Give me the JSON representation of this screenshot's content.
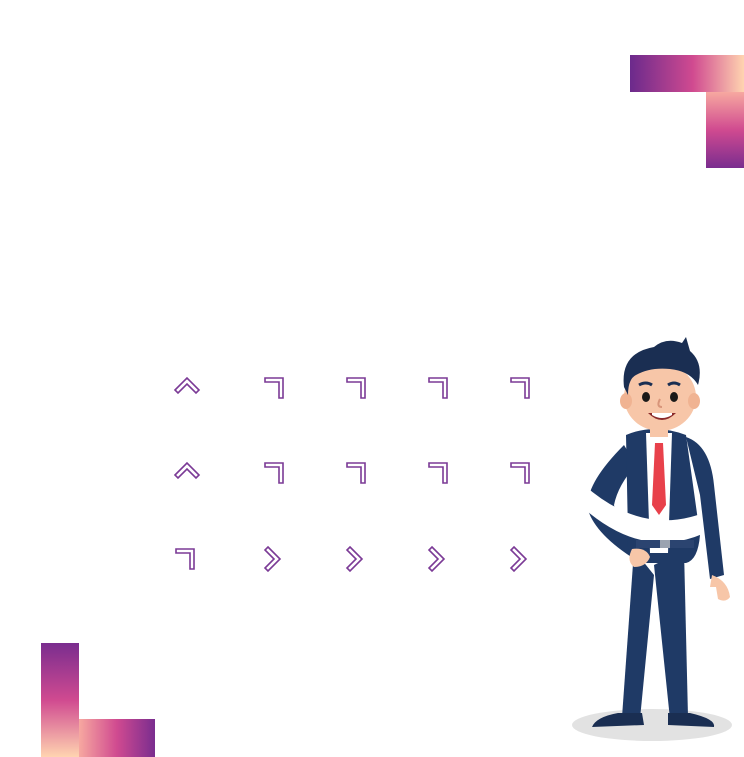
{
  "colors": {
    "gradient_dark": "#6b2a8c",
    "gradient_mid": "#c8428f",
    "gradient_light": "#ffd9b0",
    "chevron_stroke": "#7b3a96",
    "suit_navy": "#1f3a66",
    "tie_red": "#e8414b",
    "shadow_gray": "#e0e0e0"
  },
  "decor": {
    "top_right_corner": "corner-bracket-icon",
    "bottom_left_corner": "corner-bracket-icon",
    "character": "businessman-illustration"
  },
  "icon_grid": [
    [
      "chevron-up-icon",
      "corner-icon",
      "corner-icon",
      "corner-icon",
      "corner-icon"
    ],
    [
      "chevron-up-icon",
      "corner-icon",
      "corner-icon",
      "corner-icon",
      "corner-icon"
    ],
    [
      "corner-icon",
      "chevron-right-icon",
      "chevron-right-icon",
      "chevron-right-icon",
      "chevron-right-icon"
    ]
  ]
}
